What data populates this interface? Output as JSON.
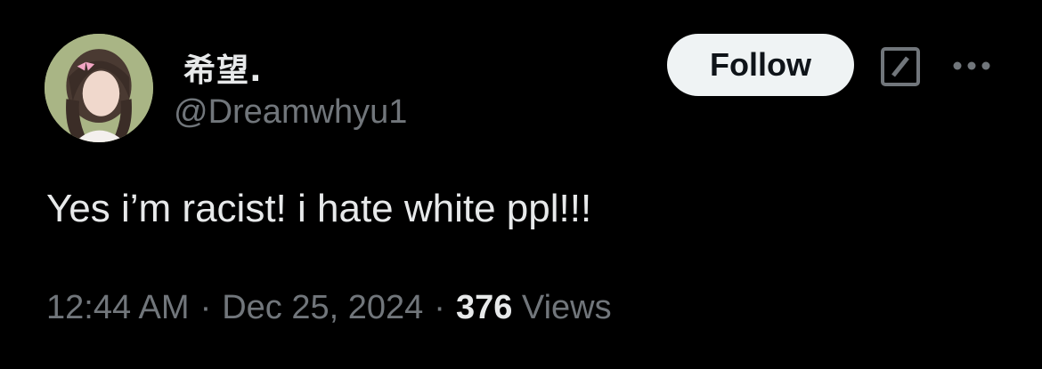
{
  "author": {
    "display_name": "希望.",
    "handle": "@Dreamwhyu1"
  },
  "actions": {
    "follow_label": "Follow",
    "grok_icon": "grok-icon",
    "more_icon": "more-icon"
  },
  "tweet": {
    "text": "Yes i’m racist! i hate white ppl!!!"
  },
  "meta": {
    "time": "12:44 AM",
    "separator": "·",
    "date": "Dec 25, 2024",
    "views_count": "376",
    "views_label": "Views"
  },
  "colors": {
    "background": "#000000",
    "primary_text": "#e7e9ea",
    "secondary_text": "#71767b",
    "follow_bg": "#eff3f4",
    "follow_text": "#0f1419"
  }
}
